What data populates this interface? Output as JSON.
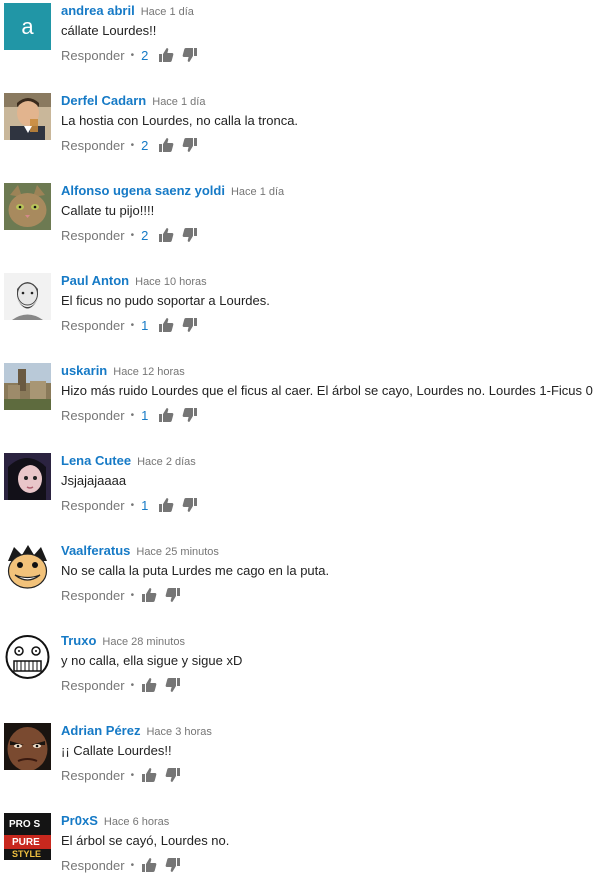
{
  "colors": {
    "author": "#167ac6",
    "meta": "#767676",
    "text": "#222222"
  },
  "comments": [
    {
      "author": "andrea abril",
      "time": "Hace 1 día",
      "text": "cállate Lourdes!!",
      "reply_label": "Responder",
      "likes": "2",
      "avatar": "letter-a-avatar",
      "avatar_letter": "a"
    },
    {
      "author": "Derfel Cadarn",
      "time": "Hace 1 día",
      "text": "La hostia con Lourdes, no calla la tronca.",
      "reply_label": "Responder",
      "likes": "2",
      "avatar": "man-drinking-avatar"
    },
    {
      "author": "Alfonso ugena saenz yoldi",
      "time": "Hace 1 día",
      "text": "Callate tu pijo!!!!",
      "reply_label": "Responder",
      "likes": "2",
      "avatar": "cat-avatar"
    },
    {
      "author": "Paul Anton",
      "time": "Hace 10 horas",
      "text": "El ficus no pudo soportar a Lourdes.",
      "reply_label": "Responder",
      "likes": "1",
      "avatar": "bearded-man-avatar"
    },
    {
      "author": "uskarin",
      "time": "Hace 12 horas",
      "text": "Hizo más ruido Lourdes que el ficus al caer. El árbol se cayo, Lourdes no. Lourdes 1-Ficus 0",
      "reply_label": "Responder",
      "likes": "1",
      "avatar": "town-photo-avatar"
    },
    {
      "author": "Lena Cutee",
      "time": "Hace 2 días",
      "text": "Jsjajajaaaa",
      "reply_label": "Responder",
      "likes": "1",
      "avatar": "girl-photo-avatar"
    },
    {
      "author": "Vaalferatus",
      "time": "Hace 25 minutos",
      "text": "No se calla la puta Lurdes me cago en la puta.",
      "reply_label": "Responder",
      "likes": "",
      "avatar": "cartoon-face-avatar"
    },
    {
      "author": "Truxo",
      "time": "Hace 28 minutos",
      "text": "y no calla, ella sigue y sigue xD",
      "reply_label": "Responder",
      "likes": "",
      "avatar": "rage-face-avatar"
    },
    {
      "author": "Adrian Pérez",
      "time": "Hace 3 horas",
      "text": "¡¡ Callate Lourdes!!",
      "reply_label": "Responder",
      "likes": "",
      "avatar": "angry-face-avatar"
    },
    {
      "author": "Pr0xS",
      "time": "Hace 6 horas",
      "text": "El árbol se cayó, Lourdes no.",
      "reply_label": "Responder",
      "likes": "",
      "avatar": "pure-style-avatar",
      "avatar_text": [
        "PRO S",
        "PURE",
        "STYLE"
      ]
    }
  ]
}
